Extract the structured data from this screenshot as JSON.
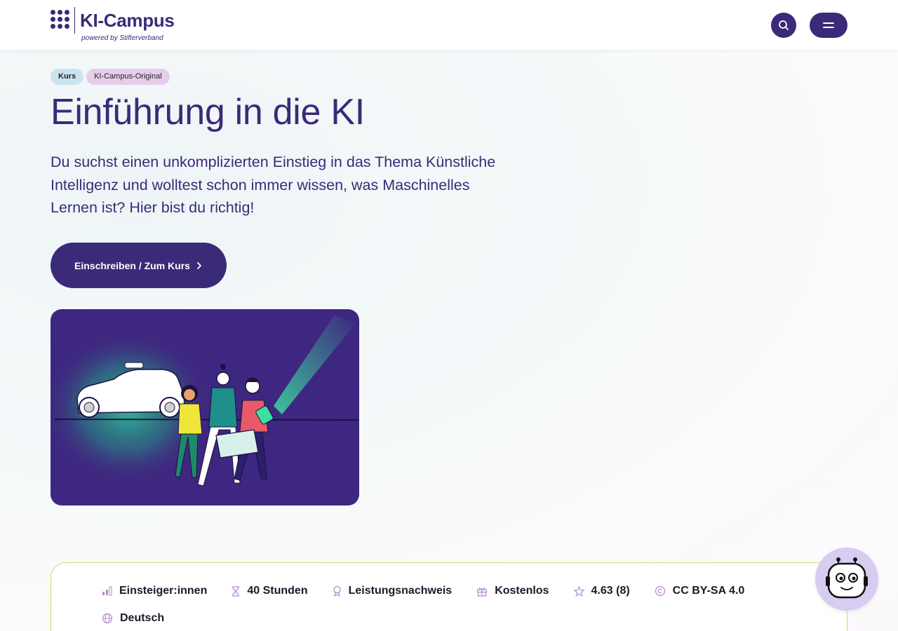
{
  "header": {
    "logo_title": "KI-Campus",
    "logo_subtitle": "powered by Stifterverband",
    "search_icon": "search-icon",
    "menu_icon": "menu-icon"
  },
  "badges": [
    "Kurs",
    "KI-Campus-Original"
  ],
  "course": {
    "title": "Einführung in die KI",
    "description": "Du suchst einen unkomplizierten Einstieg in das Thema Künstliche Intelligenz und wolltest schon immer wissen, was Maschinelles Lernen ist? Hier bist du richtig!",
    "cta_label": "Einschreiben / Zum Kurs"
  },
  "info": {
    "level": "Einsteiger:innen",
    "duration": "40 Stunden",
    "certificate": "Leistungsnachweis",
    "price": "Kostenlos",
    "rating": "4.63 (8)",
    "license": "CC BY-SA 4.0",
    "language": "Deutsch"
  },
  "colors": {
    "brand": "#3b2a78",
    "badge_kurs": "#c9e4f0",
    "badge_original": "#e6cdeb",
    "card_border": "#c9e36a",
    "icon_accent": "#b58ac9",
    "chatbot_bg": "#d6cdf0"
  }
}
